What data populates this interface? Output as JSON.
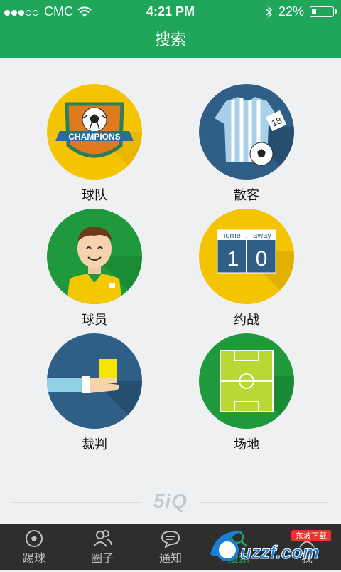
{
  "status": {
    "carrier": "CMC",
    "time": "4:21 PM",
    "battery_percent": "22%",
    "battery_level": 0.22
  },
  "header": {
    "title": "搜索"
  },
  "categories": [
    {
      "label": "球队",
      "icon": "champions-badge-icon",
      "badge_text": "CHAMPIONS"
    },
    {
      "label": "散客",
      "icon": "jersey-icon",
      "jersey_number": "18"
    },
    {
      "label": "球员",
      "icon": "player-avatar-icon"
    },
    {
      "label": "约战",
      "icon": "scoreboard-icon",
      "home": "home",
      "away": "away",
      "home_score": "1",
      "away_score": "0"
    },
    {
      "label": "裁判",
      "icon": "yellow-card-icon"
    },
    {
      "label": "场地",
      "icon": "soccer-field-icon"
    }
  ],
  "footer": {
    "brand": "5iQ"
  },
  "tabs": [
    {
      "label": "踢球",
      "icon": "soccer-ball-icon"
    },
    {
      "label": "圈子",
      "icon": "people-icon"
    },
    {
      "label": "通知",
      "icon": "chat-bubble-icon"
    },
    {
      "label": "搜索",
      "icon": "search-icon",
      "active": true
    },
    {
      "label": "我",
      "icon": "user-icon"
    }
  ],
  "watermark": {
    "text": "uzzf.com",
    "badge": "东坡下载"
  },
  "colors": {
    "primary": "#1fa65a",
    "tabbar": "#2e2e2e",
    "background": "#eef0f2"
  }
}
